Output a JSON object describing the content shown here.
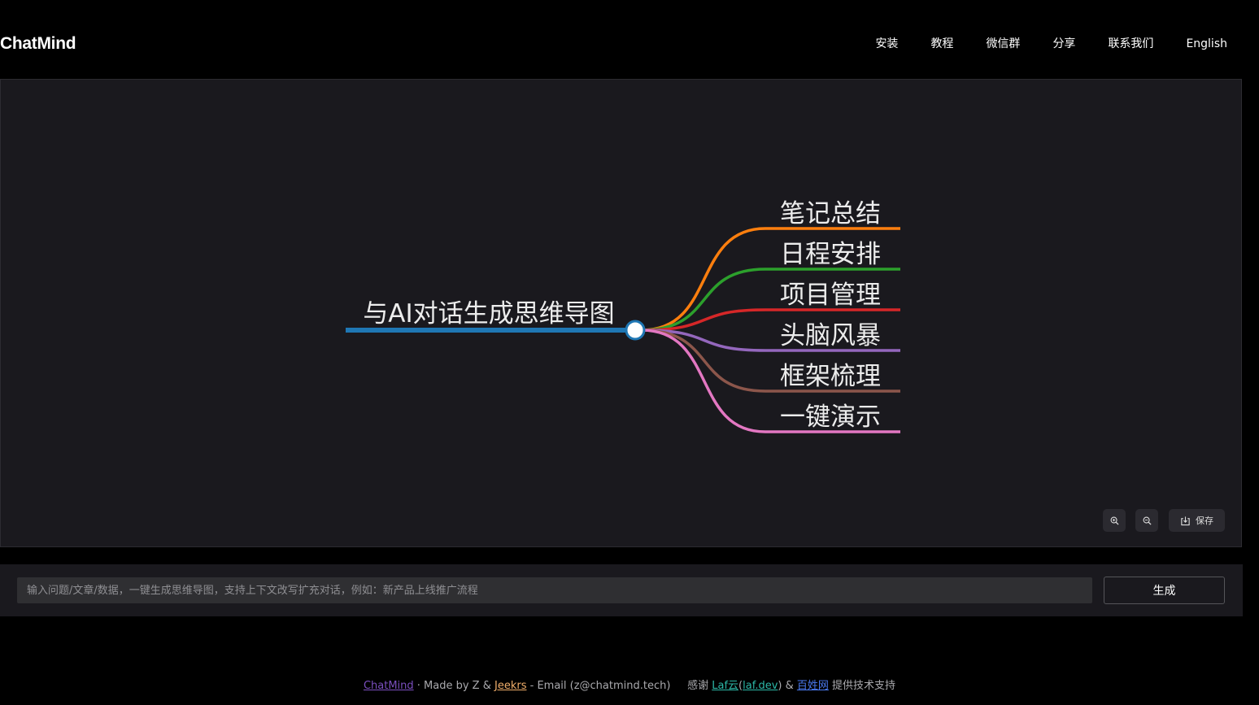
{
  "header": {
    "brand": "ChatMind",
    "nav": [
      "安装",
      "教程",
      "微信群",
      "分享",
      "联系我们",
      "English"
    ]
  },
  "mindmap": {
    "root": "与AI对话生成思维导图",
    "root_color": "#1f77b4",
    "branches": [
      {
        "label": "笔记总结",
        "color": "#ff7f0e"
      },
      {
        "label": "日程安排",
        "color": "#2ca02c"
      },
      {
        "label": "项目管理",
        "color": "#d62728"
      },
      {
        "label": "头脑风暴",
        "color": "#9467bd"
      },
      {
        "label": "框架梳理",
        "color": "#8c564b"
      },
      {
        "label": "一键演示",
        "color": "#e377c2"
      }
    ]
  },
  "controls": {
    "zoom_in_icon": "zoom-in-icon",
    "zoom_out_icon": "zoom-out-icon",
    "save_label": "保存"
  },
  "input": {
    "placeholder": "输入问题/文章/数据，一键生成思维导图，支持上下文改写扩充对话，例如：新产品上线推广流程",
    "value": "",
    "generate_label": "生成"
  },
  "footer": {
    "chatmind": "ChatMind",
    "made_by": " · Made by Z & ",
    "jeekrs": "Jeekrs",
    "email": " - Email (z@chatmind.tech)     感谢 ",
    "laf": "Laf云",
    "laf_open": "(",
    "laf_dev": "laf.dev",
    "laf_close": ") & ",
    "baixing": "百姓网",
    "support": " 提供技术支持"
  }
}
